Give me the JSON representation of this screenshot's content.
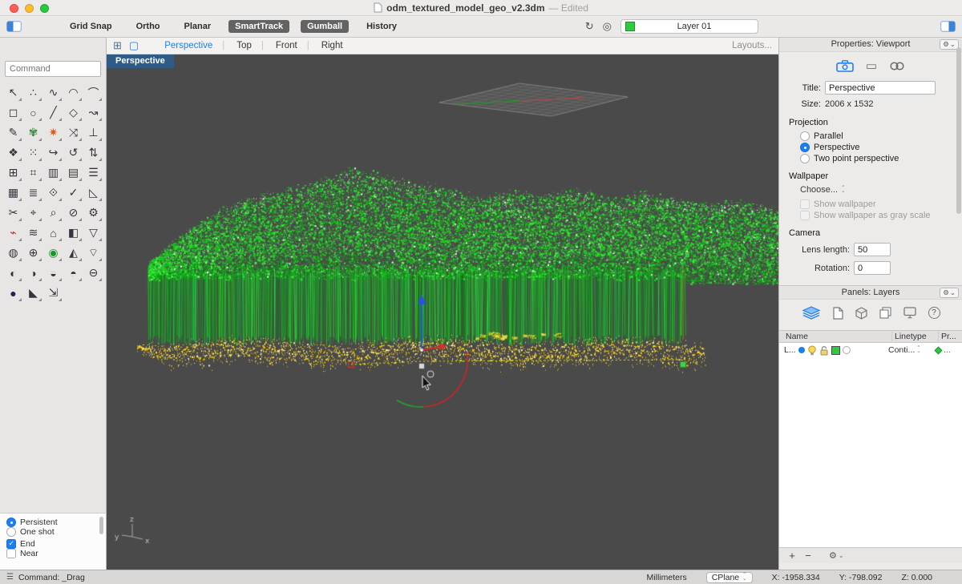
{
  "colors": {
    "accent": "#1c7ef0",
    "layer_green": "#2ecb3f",
    "viewport_bg": "#4a4a4a",
    "badge_bg": "#2e5c86"
  },
  "titlebar": {
    "title": "odm_textured_model_geo_v2.3dm",
    "edited": "— Edited"
  },
  "toolbar": {
    "toggles": [
      {
        "label": "Grid Snap"
      },
      {
        "label": "Ortho"
      },
      {
        "label": "Planar"
      },
      {
        "label": "SmartTrack",
        "active": true
      },
      {
        "label": "Gumball",
        "active": true
      },
      {
        "label": "History"
      }
    ],
    "render_icon": "↻",
    "target_icon": "◎",
    "layer_pill": "Layer 01"
  },
  "tabs": {
    "grid_icon": "⊞",
    "viewport_icon": "▢",
    "items": [
      {
        "label": "Perspective",
        "active": true
      },
      {
        "label": "Top"
      },
      {
        "label": "Front"
      },
      {
        "label": "Right"
      }
    ],
    "layouts": "Layouts..."
  },
  "viewport": {
    "badge": "Perspective"
  },
  "command": {
    "placeholder": "Command"
  },
  "palette": {
    "icons": [
      {
        "g": "↖"
      },
      {
        "g": "∴"
      },
      {
        "g": "∿"
      },
      {
        "g": "◠"
      },
      {
        "g": "⌒"
      },
      {
        "g": "◻"
      },
      {
        "g": "○"
      },
      {
        "g": "╱"
      },
      {
        "g": "◇"
      },
      {
        "g": "↝"
      },
      {
        "g": "✎"
      },
      {
        "g": "✾",
        "c": "#3c8a3c"
      },
      {
        "g": "✷",
        "c": "#e05a1a"
      },
      {
        "g": "⤨"
      },
      {
        "g": "⊥"
      },
      {
        "g": "❖"
      },
      {
        "g": "⁙"
      },
      {
        "g": "↪"
      },
      {
        "g": "↺"
      },
      {
        "g": "⇅"
      },
      {
        "g": "⊞"
      },
      {
        "g": "⌗"
      },
      {
        "g": "▥"
      },
      {
        "g": "▤"
      },
      {
        "g": "☰"
      },
      {
        "g": "▦"
      },
      {
        "g": "≣"
      },
      {
        "g": "⟐"
      },
      {
        "g": "✓"
      },
      {
        "g": "◺"
      },
      {
        "g": "✂"
      },
      {
        "g": "⌖"
      },
      {
        "g": "⌕"
      },
      {
        "g": "⊘"
      },
      {
        "g": "⚙"
      },
      {
        "g": "⌁",
        "c": "#c03020"
      },
      {
        "g": "≋"
      },
      {
        "g": "⌂"
      },
      {
        "g": "◧"
      },
      {
        "g": "▽"
      },
      {
        "g": "◍"
      },
      {
        "g": "⊕"
      },
      {
        "g": "◉",
        "c": "#159a2a"
      },
      {
        "g": "◭"
      },
      {
        "g": "⌔"
      },
      {
        "g": "◐"
      },
      {
        "g": "◑"
      },
      {
        "g": "◒"
      },
      {
        "g": "◓"
      },
      {
        "g": "⊖"
      },
      {
        "g": "●",
        "c": "#20264f"
      },
      {
        "g": "◣"
      },
      {
        "g": "⇲"
      }
    ]
  },
  "snap": {
    "radios": [
      {
        "label": "Persistent",
        "selected": true
      },
      {
        "label": "One shot"
      }
    ],
    "checks": [
      {
        "label": "End",
        "checked": true
      },
      {
        "label": "Near"
      }
    ]
  },
  "properties": {
    "header": "Properties: Viewport",
    "gear": "⚙",
    "chev": "⌄",
    "chev_up": "⌃",
    "display_icon": "▭",
    "title_label": "Title:",
    "title_value": "Perspective",
    "size_label": "Size:",
    "size_value": "2006 x 1532",
    "projection_label": "Projection",
    "projection_options": [
      {
        "label": "Parallel"
      },
      {
        "label": "Perspective",
        "selected": true
      },
      {
        "label": "Two point perspective"
      }
    ],
    "wallpaper_label": "Wallpaper",
    "choose_label": "Choose...",
    "wallpaper_checks": [
      {
        "label": "Show wallpaper"
      },
      {
        "label": "Show wallpaper as gray scale"
      }
    ],
    "camera_label": "Camera",
    "lens_label": "Lens length:",
    "lens_value": "50",
    "rotation_label": "Rotation:",
    "rotation_value": "0"
  },
  "layers": {
    "header": "Panels: Layers",
    "col_name": "Name",
    "col_linetype": "Linetype",
    "col_print": "Pr...",
    "row_name": "L...",
    "row_linetype": "Conti...",
    "row_trail": "...",
    "plus": "+",
    "minus": "−",
    "help_glyph": "?"
  },
  "statusbar": {
    "menu_icon": "☰",
    "command": "Command: _Drag",
    "units": "Millimeters",
    "cplane": "CPlane",
    "x": "X: -1958.334",
    "y": "Y: -798.092",
    "z": "Z: 0.000"
  }
}
